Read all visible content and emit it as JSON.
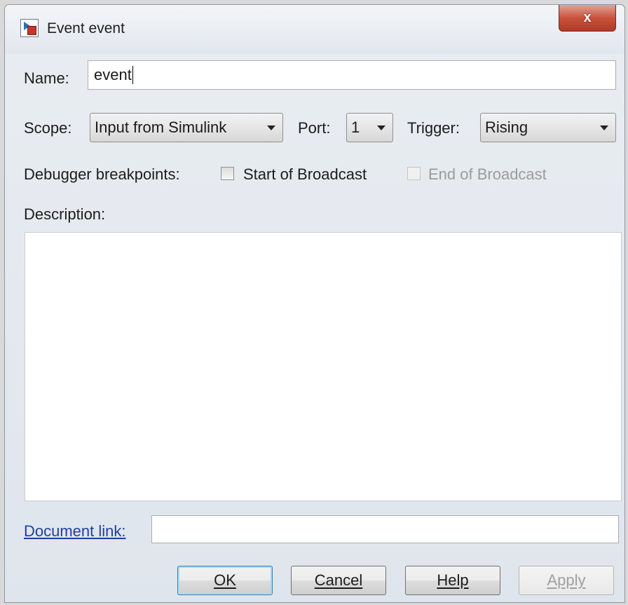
{
  "window": {
    "title": "Event event",
    "close_label": "x"
  },
  "name": {
    "label": "Name:",
    "value": "event"
  },
  "scope": {
    "label": "Scope:",
    "value": "Input from Simulink"
  },
  "port": {
    "label": "Port:",
    "value": "1"
  },
  "trigger": {
    "label": "Trigger:",
    "value": "Rising"
  },
  "breakpoints": {
    "label": "Debugger breakpoints:",
    "start_label": "Start of Broadcast",
    "start_checked": false,
    "end_label": "End of Broadcast",
    "end_enabled": false
  },
  "description": {
    "label": "Description:",
    "value": ""
  },
  "document_link": {
    "label": "Document link:",
    "value": ""
  },
  "buttons": {
    "ok": "OK",
    "cancel": "Cancel",
    "help": "Help",
    "apply": "Apply"
  }
}
